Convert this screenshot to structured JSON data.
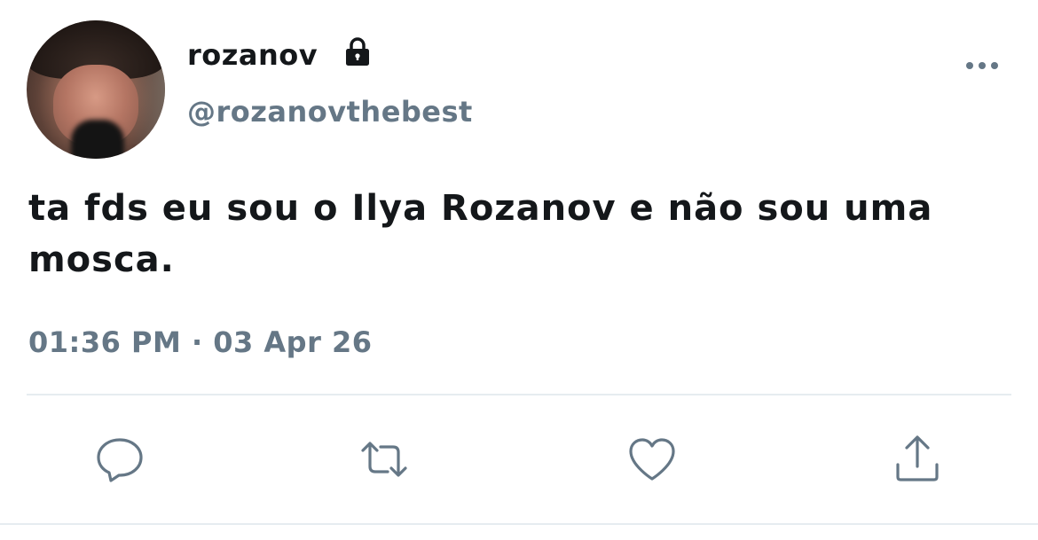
{
  "user": {
    "display_name": "rozanov",
    "handle": "@rozanovthebest",
    "locked_icon": "lock-icon",
    "avatar": "profile-photo"
  },
  "menu_icon": "more-horizontal-icon",
  "tweet": {
    "text": "ta fds eu sou o Ilya Rozanov e não sou uma mosca.",
    "timestamp": "01:36 PM · 03 Apr 26"
  },
  "actions": [
    {
      "name": "reply",
      "icon": "speech-bubble-icon"
    },
    {
      "name": "retweet",
      "icon": "retweet-arrows-icon"
    },
    {
      "name": "like",
      "icon": "heart-icon"
    },
    {
      "name": "share",
      "icon": "share-upload-icon"
    }
  ],
  "colors": {
    "text_primary": "#14171a",
    "text_secondary": "#657786",
    "divider": "#e6ecf0",
    "background": "#ffffff"
  }
}
